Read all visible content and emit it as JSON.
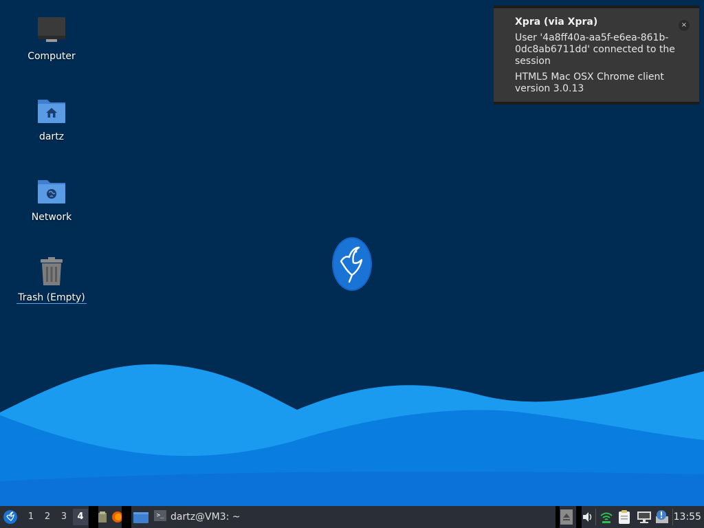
{
  "desktop": {
    "background_color": "#002b52",
    "icons": [
      {
        "label": "Computer",
        "icon": "computer-icon"
      },
      {
        "label": "dartz",
        "icon": "home-folder-icon"
      },
      {
        "label": "Network",
        "icon": "network-folder-icon"
      },
      {
        "label": "Trash (Empty)",
        "icon": "trash-icon"
      }
    ],
    "center_logo": "bird-logo"
  },
  "notification": {
    "title": "Xpra (via Xpra)",
    "line1": "User '4a8ff40a-aa5f-e6ea-861b-0dc8ab6711dd' connected to the session",
    "line2": "HTML5 Mac OSX Chrome client version 3.0.13",
    "close_symbol": "×"
  },
  "taskbar": {
    "menu_icon": "start-menu-icon",
    "workspaces": [
      "1",
      "2",
      "3",
      "4"
    ],
    "active_workspace": "4",
    "launchers": [
      "file-manager-icon",
      "firefox-icon",
      "show-desktop-icon"
    ],
    "task_label": "dartz@VM3: ~",
    "task_icon_glyph": ">_",
    "tray_icons": [
      "eject-icon",
      "audio-icon",
      "wifi-icon",
      "clipboard-icon",
      "network-wired-icon",
      "update-notifier-icon"
    ],
    "clock": "13:55"
  },
  "colors": {
    "panel": "#2a2e36",
    "notification_bg": "#383838",
    "wave_light": "#1a9bef",
    "wave_mid": "#0a7de0",
    "wave_deep": "#0b6bd6"
  }
}
